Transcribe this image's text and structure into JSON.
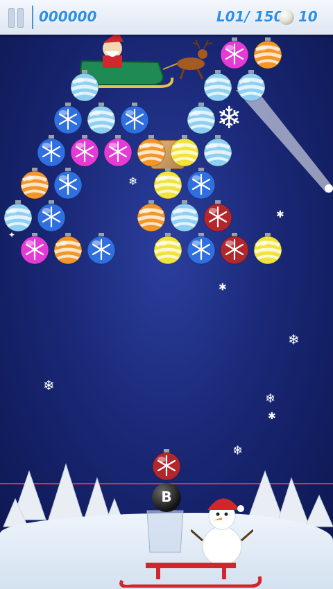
{
  "hud": {
    "score": "000000",
    "level": "L01/ 150",
    "shots": "10"
  },
  "colors": {
    "blue": "#2f6fe0",
    "lightblue": "#8fd0f2",
    "pink": "#e43bd7",
    "orange": "#f3962a",
    "yellow": "#f1e23c",
    "red": "#b3262c",
    "deadline": "#e0303a",
    "hud_text": "#2f8fe6"
  },
  "balls": [
    {
      "row": 0,
      "col": 6.5,
      "color": "pink",
      "pattern": "snowflake"
    },
    {
      "row": 0,
      "col": 7.5,
      "color": "orange",
      "pattern": "stripes"
    },
    {
      "row": 1,
      "col": 2,
      "color": "lightblue",
      "pattern": "stripes"
    },
    {
      "row": 1,
      "col": 6,
      "color": "lightblue",
      "pattern": "stripes"
    },
    {
      "row": 1,
      "col": 7,
      "color": "lightblue",
      "pattern": "stripes"
    },
    {
      "row": 2,
      "col": 1.5,
      "color": "blue",
      "pattern": "snowflake"
    },
    {
      "row": 2,
      "col": 2.5,
      "color": "lightblue",
      "pattern": "stripes"
    },
    {
      "row": 2,
      "col": 3.5,
      "color": "blue",
      "pattern": "snowflake"
    },
    {
      "row": 2,
      "col": 5.5,
      "color": "lightblue",
      "pattern": "stripes"
    },
    {
      "row": 3,
      "col": 1,
      "color": "blue",
      "pattern": "snowflake"
    },
    {
      "row": 3,
      "col": 2,
      "color": "pink",
      "pattern": "snowflake"
    },
    {
      "row": 3,
      "col": 3,
      "color": "pink",
      "pattern": "snowflake"
    },
    {
      "row": 3,
      "col": 4,
      "color": "orange",
      "pattern": "stripes"
    },
    {
      "row": 3,
      "col": 5,
      "color": "yellow",
      "pattern": "stripes"
    },
    {
      "row": 3,
      "col": 6,
      "color": "lightblue",
      "pattern": "stripes"
    },
    {
      "row": 4,
      "col": 0.5,
      "color": "orange",
      "pattern": "stripes"
    },
    {
      "row": 4,
      "col": 1.5,
      "color": "blue",
      "pattern": "snowflake"
    },
    {
      "row": 4,
      "col": 4.5,
      "color": "yellow",
      "pattern": "stripes"
    },
    {
      "row": 4,
      "col": 5.5,
      "color": "blue",
      "pattern": "snowflake"
    },
    {
      "row": 5,
      "col": 0,
      "color": "lightblue",
      "pattern": "stripes"
    },
    {
      "row": 5,
      "col": 1,
      "color": "blue",
      "pattern": "snowflake"
    },
    {
      "row": 5,
      "col": 4,
      "color": "orange",
      "pattern": "stripes"
    },
    {
      "row": 5,
      "col": 5,
      "color": "lightblue",
      "pattern": "stripes"
    },
    {
      "row": 5,
      "col": 6,
      "color": "red",
      "pattern": "snowflake"
    },
    {
      "row": 6,
      "col": 0.5,
      "color": "pink",
      "pattern": "snowflake"
    },
    {
      "row": 6,
      "col": 1.5,
      "color": "orange",
      "pattern": "stripes"
    },
    {
      "row": 6,
      "col": 2.5,
      "color": "blue",
      "pattern": "snowflake"
    },
    {
      "row": 6,
      "col": 4.5,
      "color": "yellow",
      "pattern": "stripes"
    },
    {
      "row": 6,
      "col": 5.5,
      "color": "blue",
      "pattern": "snowflake"
    },
    {
      "row": 6,
      "col": 6.5,
      "color": "red",
      "pattern": "snowflake"
    },
    {
      "row": 6,
      "col": 7.5,
      "color": "yellow",
      "pattern": "stripes"
    }
  ],
  "next_ball": {
    "color": "red",
    "pattern": "snowflake"
  },
  "bomb_label": "B"
}
